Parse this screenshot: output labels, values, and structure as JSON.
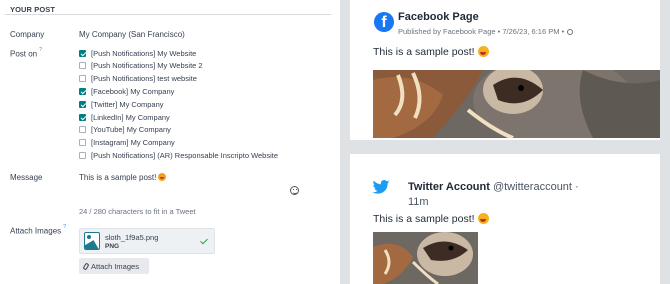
{
  "form": {
    "section_title": "YOUR POST",
    "company_label": "Company",
    "company_value": "My Company (San Francisco)",
    "post_on_label": "Post on",
    "post_on_help": "?",
    "accounts": [
      {
        "label": "[Push Notifications] My Website",
        "checked": true
      },
      {
        "label": "[Push Notifications] My Website 2",
        "checked": false
      },
      {
        "label": "[Push Notifications] test website",
        "checked": false
      },
      {
        "label": "[Facebook] My Company",
        "checked": true
      },
      {
        "label": "[Twitter] My Company",
        "checked": true
      },
      {
        "label": "[LinkedIn] My Company",
        "checked": true
      },
      {
        "label": "[YouTube] My Company",
        "checked": false
      },
      {
        "label": "[Instagram] My Company",
        "checked": false
      },
      {
        "label": "[Push Notifications] (AR) Responsable Inscripto Website",
        "checked": false
      }
    ],
    "message_label": "Message",
    "message_value": "This is a sample post!",
    "char_count": "24 / 280 characters to fit in a Tweet",
    "attach_label": "Attach Images",
    "attach_help": "?",
    "attachment_name": "sloth_1f9a5.png",
    "attachment_type": "PNG",
    "attach_button": "Attach Images"
  },
  "preview": {
    "facebook": {
      "page_name": "Facebook Page",
      "meta": "Published by Facebook Page • 7/26/23, 6:16 PM •",
      "text": "This is a sample post!"
    },
    "twitter": {
      "name": "Twitter Account",
      "handle": "@twitteraccount ·",
      "time": "11m",
      "text": "This is a sample post!"
    }
  },
  "colors": {
    "checkbox_on": "#017e84",
    "facebook_blue": "#1877f2",
    "twitter_blue": "#1d9bf0",
    "preview_background": "#dfe2e5"
  }
}
